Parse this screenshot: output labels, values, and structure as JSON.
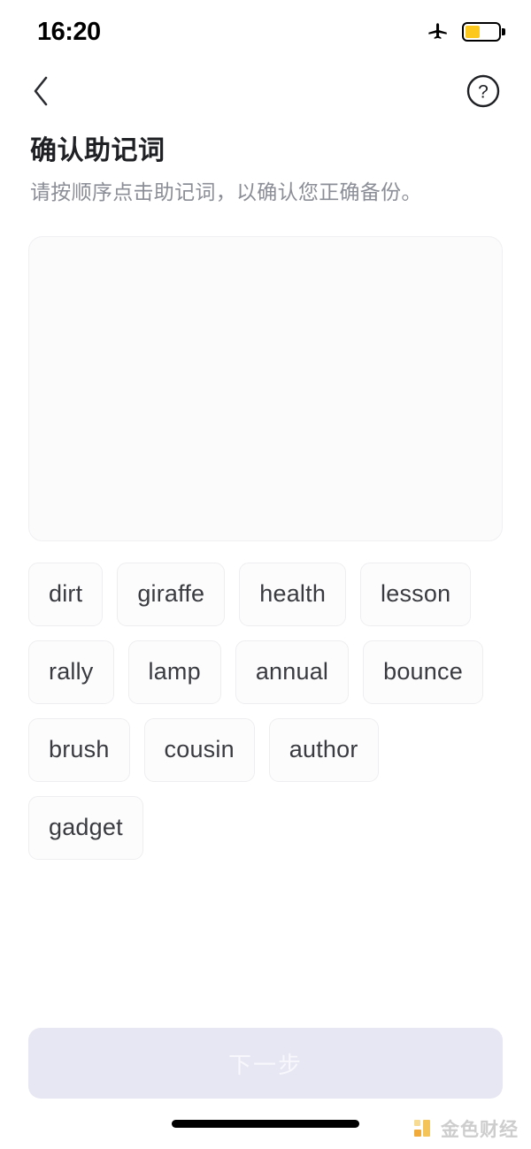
{
  "status_bar": {
    "time": "16:20",
    "airplane_icon": "airplane-mode-icon",
    "battery_icon": "battery-low-power-icon",
    "battery_level_percent": 45,
    "battery_color": "#fcc81e"
  },
  "nav": {
    "back_icon": "chevron-left-icon",
    "help_icon": "question-circle-icon"
  },
  "header": {
    "title": "确认助记词",
    "subtitle": "请按顺序点击助记词，以确认您正确备份。"
  },
  "answer_panel": {
    "selected_words": [],
    "background_color": "#fbfbfc"
  },
  "word_pool": {
    "words": [
      "dirt",
      "giraffe",
      "health",
      "lesson",
      "rally",
      "lamp",
      "annual",
      "bounce",
      "brush",
      "cousin",
      "author",
      "gadget"
    ]
  },
  "footer": {
    "next_label": "下一步",
    "next_enabled": false,
    "next_background_color": "#e7e7f3",
    "next_text_color": "#f7f7fc"
  },
  "watermark": {
    "text": "金色财经",
    "logo_color": "#f0a42a"
  }
}
